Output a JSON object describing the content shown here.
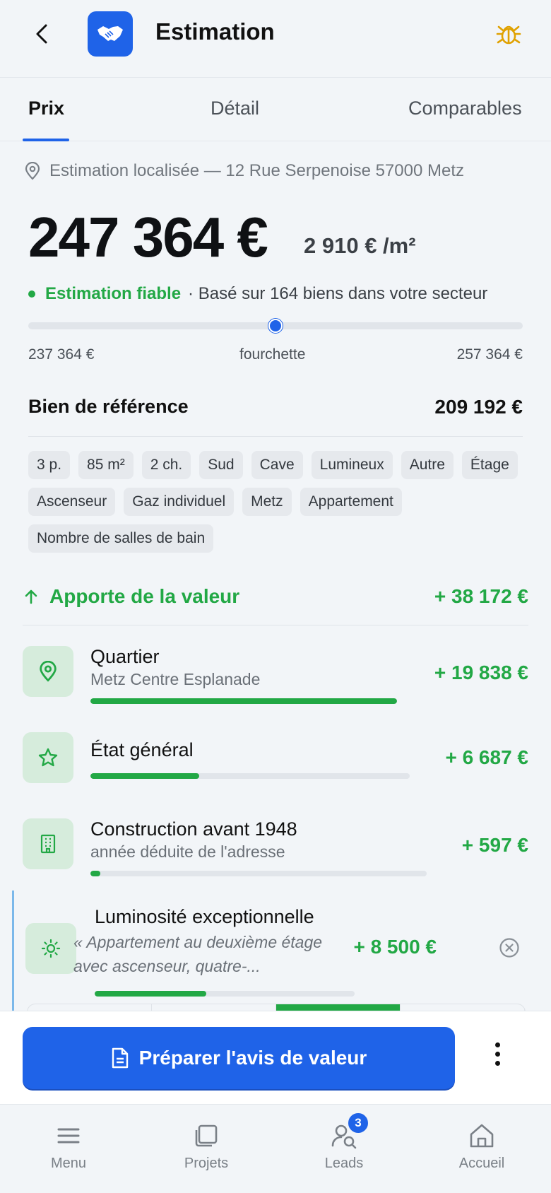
{
  "header": {
    "title": "Estimation"
  },
  "tabs": [
    {
      "label": "Prix"
    },
    {
      "label": "Détail"
    },
    {
      "label": "Comparables"
    }
  ],
  "location": "Estimation localisée — 12 Rue Serpenoise 57000 Metz",
  "price": {
    "value": "247 364 €",
    "per_m2": "2 910 € /m²"
  },
  "reliability": {
    "status": "Estimation fiable",
    "detail": "· Basé sur 164 biens dans votre secteur"
  },
  "range": {
    "low": "237 364 €",
    "label": "fourchette",
    "high": "257 364 €",
    "position": 0.5
  },
  "reference": {
    "label": "Bien de référence",
    "value": "209 192 €"
  },
  "chips": [
    "3 p.",
    "85 m²",
    "2 ch.",
    "Sud",
    "Cave",
    "Lumineux",
    "Autre",
    "Étage",
    "Ascenseur",
    "Gaz individuel",
    "Metz",
    "Appartement",
    "Nombre de salles de bain"
  ],
  "value_section": {
    "label": "Apporte de la valeur",
    "total": "+ 38 172 €"
  },
  "factors": [
    {
      "title": "Quartier",
      "subtitle": "Metz Centre Esplanade",
      "amount": "+ 19 838 €",
      "icon": "location-pin-icon",
      "progress": 1.0
    },
    {
      "title": "État général",
      "subtitle": "",
      "amount": "+ 6 687 €",
      "icon": "star-icon",
      "progress": 0.34
    },
    {
      "title": "Construction avant 1948",
      "subtitle": "année déduite de l'adresse",
      "amount": "+ 597 €",
      "icon": "building-icon",
      "progress": 0.03
    },
    {
      "title": "Luminosité exceptionnelle",
      "quote": "« Appartement au deuxième étage avec ascenseur, quatre-...",
      "amount": "+ 8 500 €",
      "icon": "sun-icon",
      "progress": 0.43
    }
  ],
  "cta": {
    "label": "Préparer l'avis de valeur"
  },
  "bottom_nav": [
    {
      "label": "Menu",
      "icon": "menu-icon"
    },
    {
      "label": "Projets",
      "icon": "folders-icon"
    },
    {
      "label": "Leads",
      "icon": "leads-icon",
      "badge": "3"
    },
    {
      "label": "Accueil",
      "icon": "home-icon"
    }
  ],
  "colors": {
    "accent": "#1f63e8",
    "positive": "#22a845",
    "bug": "#e0a100"
  }
}
